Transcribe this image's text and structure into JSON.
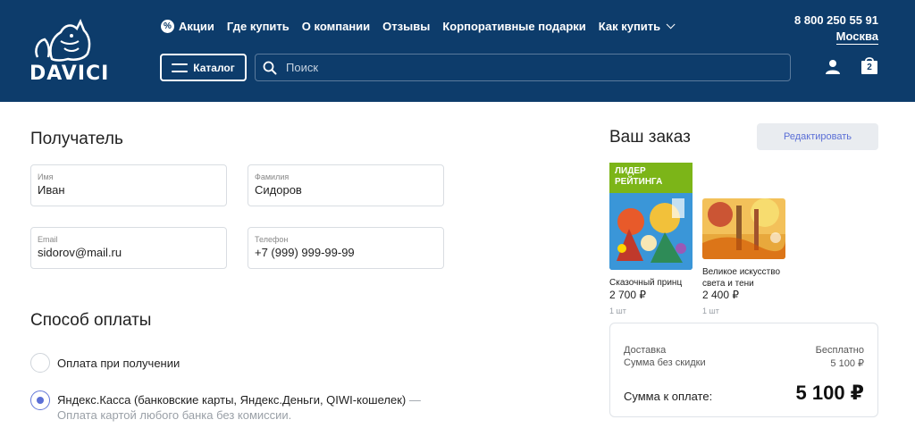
{
  "header": {
    "logo_text": "DAVICI",
    "nav": [
      {
        "label": "Акции",
        "icon": "percent-icon"
      },
      {
        "label": "Где купить"
      },
      {
        "label": "О компании"
      },
      {
        "label": "Отзывы"
      },
      {
        "label": "Корпоративные подарки"
      },
      {
        "label": "Как купить",
        "icon": "chevron-down-icon"
      }
    ],
    "phone": "8 800 250 55 91",
    "city": "Москва",
    "catalog_label": "Каталог",
    "search_placeholder": "Поиск",
    "cart_count": "2"
  },
  "recipient": {
    "title": "Получатель",
    "fields": [
      {
        "label": "Имя",
        "value": "Иван"
      },
      {
        "label": "Фамилия",
        "value": "Сидоров"
      },
      {
        "label": "Email",
        "value": "sidorov@mail.ru"
      },
      {
        "label": "Телефон",
        "value": "+7 (999) 999-99-99"
      }
    ]
  },
  "payment": {
    "title": "Способ оплаты",
    "options": [
      {
        "label": "Оплата при получении",
        "selected": false
      },
      {
        "label": "Яндекс.Касса (банковские карты, Яндекс.Деньги, QIWI-кошелек)",
        "note": " — Оплата картой любого банка без комиссии.",
        "selected": true
      }
    ]
  },
  "order": {
    "title": "Ваш заказ",
    "edit_label": "Редактировать",
    "items": [
      {
        "badge": "Лидер рейтинга",
        "name": "Сказочный принц",
        "price": "2 700 ₽",
        "qty": "1 шт"
      },
      {
        "name": "Великое искусство света и тени",
        "price": "2 400 ₽",
        "qty": "1 шт"
      }
    ],
    "summary": {
      "delivery_label": "Доставка",
      "delivery_value": "Бесплатно",
      "subtotal_label": "Сумма без скидки",
      "subtotal_value": "5 100 ₽",
      "total_label": "Сумма к оплате:",
      "total_value": "5 100 ₽"
    }
  },
  "colors": {
    "header_bg": "#0d3c6b",
    "accent": "#5b6fd6",
    "badge_green": "#7cb518"
  }
}
